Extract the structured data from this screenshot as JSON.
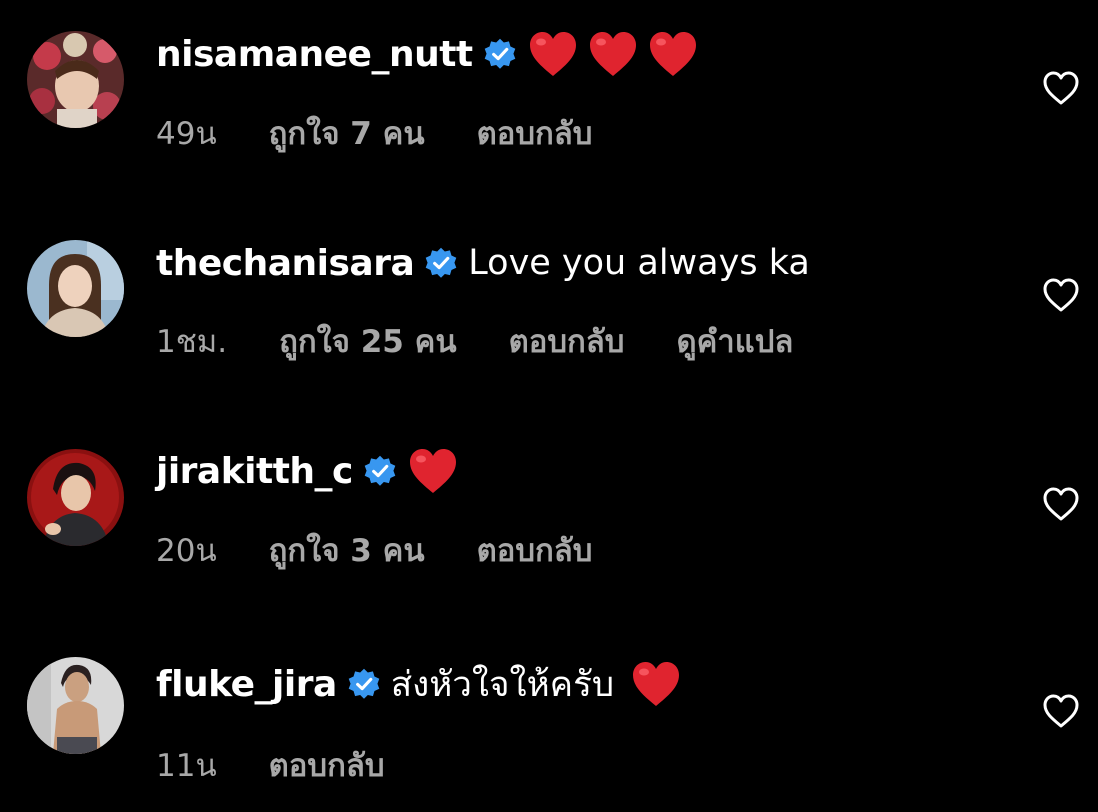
{
  "colors": {
    "background": "#000000",
    "text_primary": "#ffffff",
    "text_secondary": "#a8a8a8",
    "verified_badge": "#3897f0",
    "heart_emoji": "#e0242f"
  },
  "icons": {
    "verified": "verified-badge-icon",
    "like": "heart-outline-icon",
    "emoji": "red-heart-emoji"
  },
  "comments": [
    {
      "username": "nisamanee_nutt",
      "text": "",
      "emoji_count": 3,
      "time": "49น",
      "likes": "ถูกใจ 7 คน",
      "reply": "ตอบกลับ",
      "translate": ""
    },
    {
      "username": "thechanisara",
      "text": "Love you always ka",
      "emoji_count": 0,
      "time": "1ชม.",
      "likes": "ถูกใจ 25 คน",
      "reply": "ตอบกลับ",
      "translate": "ดูคำแปล"
    },
    {
      "username": "jirakitth_c",
      "text": "",
      "emoji_count": 1,
      "time": "20น",
      "likes": "ถูกใจ 3 คน",
      "reply": "ตอบกลับ",
      "translate": ""
    },
    {
      "username": "fluke_jira",
      "text": "ส่งหัวใจให้ครับ",
      "emoji_count": 1,
      "time": "11น",
      "likes": "",
      "reply": "ตอบกลับ",
      "translate": ""
    }
  ]
}
